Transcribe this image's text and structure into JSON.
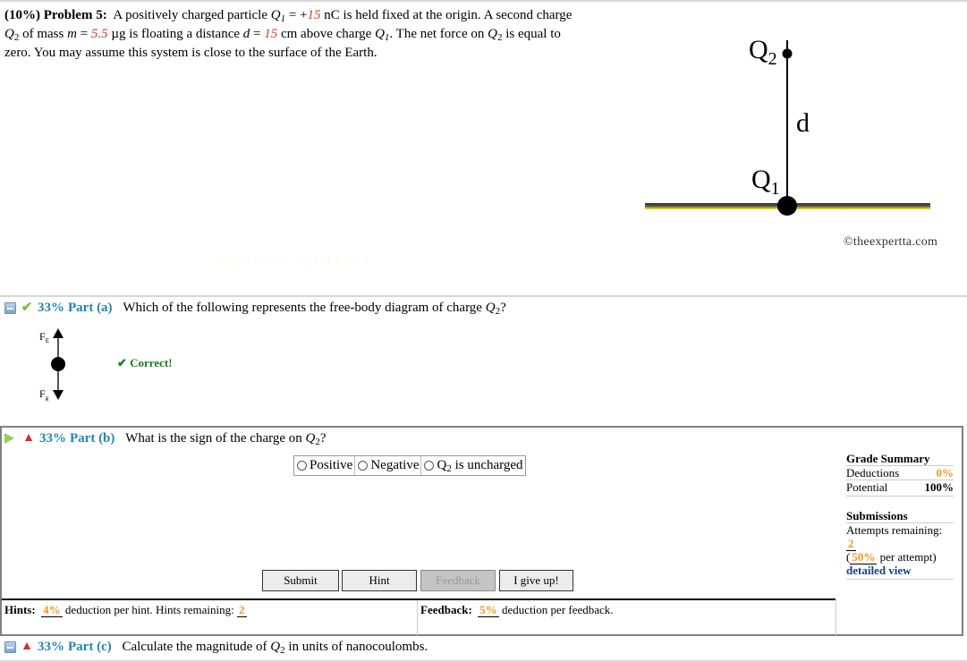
{
  "problem": {
    "weight": "(10%)",
    "label": "Problem 5:",
    "text_1": "A positively charged particle ",
    "q1_symbol": "Q",
    "q1_sub": "1",
    "text_2": " = +",
    "q1_value": "15",
    "text_3": " nC is held fixed at the origin. A second charge",
    "q2_symbol": "Q",
    "q2_sub": "2",
    "text_4": " of mass ",
    "m_symbol": "m",
    "text_5": " = ",
    "m_value": "5.5",
    "text_6": " µg is floating a distance ",
    "d_symbol": "d",
    "text_7": " = ",
    "d_value": "15",
    "text_8": " cm above charge ",
    "text_9": ". The net force on ",
    "text_10": " is equal to",
    "text_11": "zero. You may assume this system is close to the surface of the Earth."
  },
  "diagram": {
    "label_q2": "Q",
    "label_q2_sub": "2",
    "label_d": "d",
    "label_q1": "Q",
    "label_q1_sub": "1",
    "copyright": "©theexpertta.com",
    "watermark": "Access Denied: AE 6 4 4 1 5 4 7 7 1"
  },
  "part_a": {
    "percent": "33%",
    "label": "Part (a)",
    "question": "Which of the following represents the free-body diagram of charge ",
    "q_symbol": "Q",
    "q_sub": "2",
    "q_end": "?",
    "fbd_top_label": "F",
    "fbd_top_sub": "E",
    "fbd_bottom_label": "F",
    "fbd_bottom_sub": "g",
    "status": "✔ Correct!"
  },
  "part_b": {
    "percent": "33%",
    "label": "Part (b)",
    "question": "What is the sign of the charge on ",
    "q_symbol": "Q",
    "q_sub": "2",
    "q_end": "?",
    "choices": [
      {
        "label": "Positive"
      },
      {
        "label": "Negative"
      },
      {
        "label_prefix": "Q",
        "label_sub": "2",
        "label_suffix": " is uncharged"
      }
    ],
    "grade_summary": {
      "title": "Grade Summary",
      "deductions_label": "Deductions",
      "deductions_value": "0%",
      "potential_label": "Potential",
      "potential_value": "100%"
    },
    "submissions": {
      "title": "Submissions",
      "attempts_label": "Attempts remaining: ",
      "attempts_value": "2",
      "per_attempt_open": "(",
      "per_attempt_value": "50%",
      "per_attempt_text": " per attempt)",
      "detailed_view": "detailed view"
    },
    "buttons": {
      "submit": "Submit",
      "hint": "Hint",
      "feedback": "Feedback",
      "give_up": "I give up!"
    },
    "hints": {
      "label": "Hints:",
      "deduction": "4%",
      "text": " deduction per hint. Hints remaining: ",
      "remaining": "2"
    },
    "feedback": {
      "label": "Feedback:",
      "deduction": "5%",
      "text": " deduction per feedback."
    }
  },
  "part_c": {
    "percent": "33%",
    "label": "Part (c)",
    "question": "Calculate the magnitude of ",
    "q_symbol": "Q",
    "q_sub": "2",
    "q_end": " in units of nanocoulombs."
  }
}
